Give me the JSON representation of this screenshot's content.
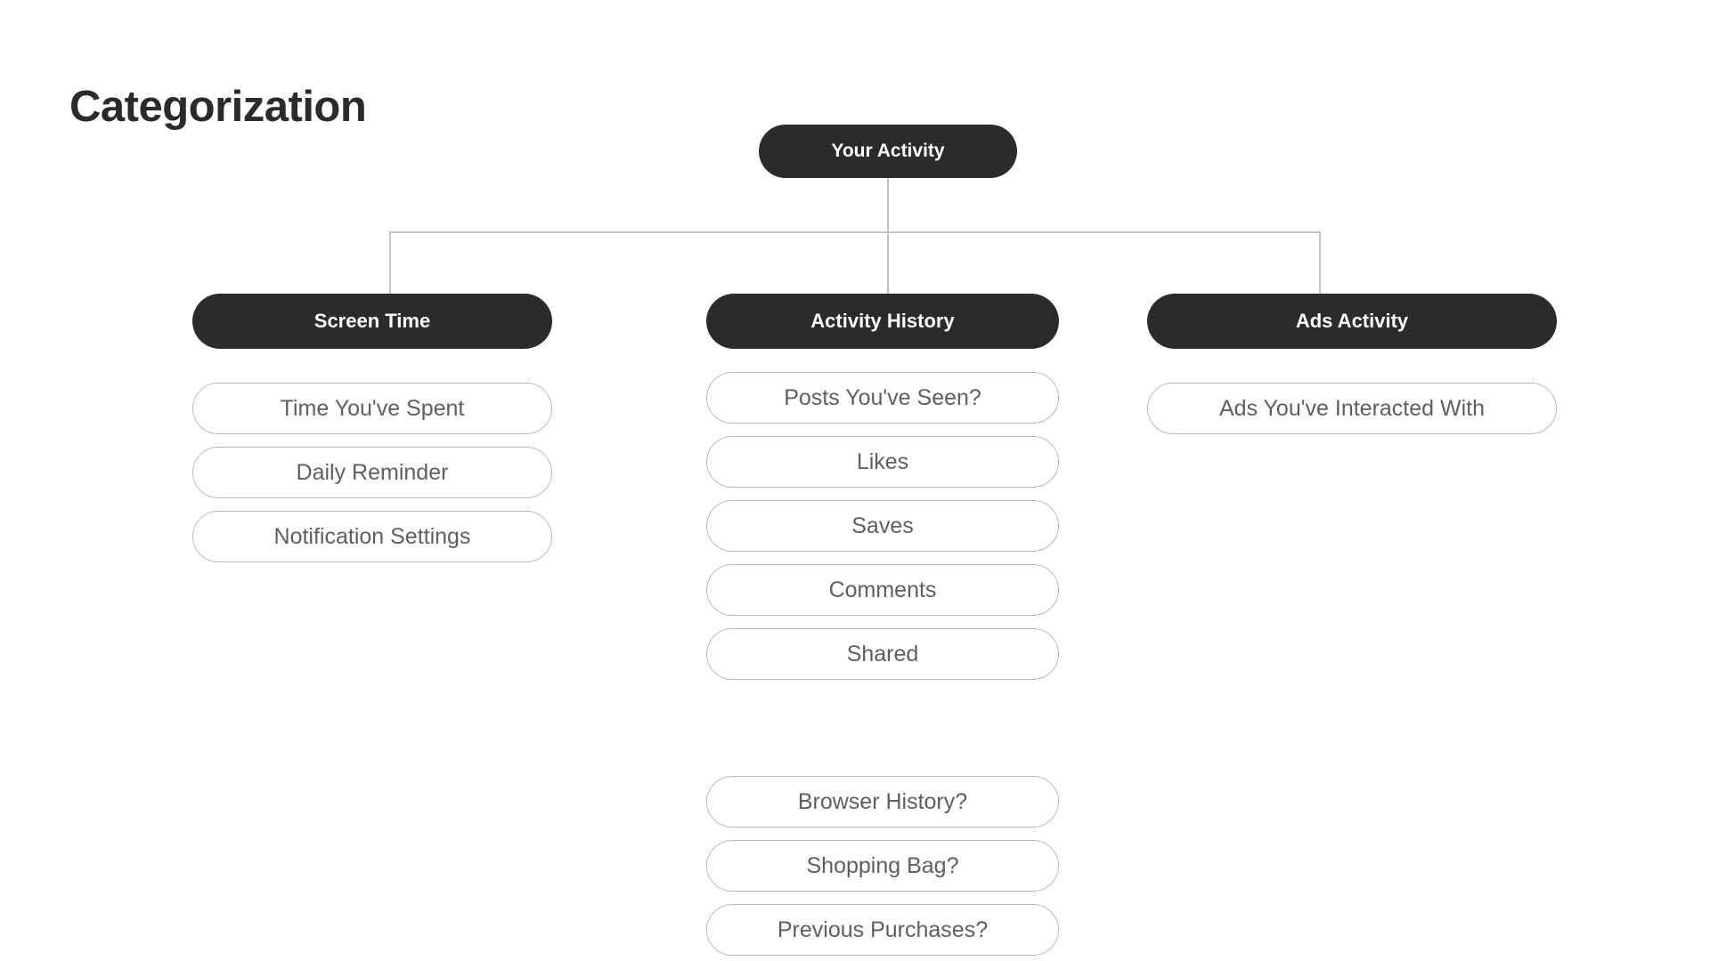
{
  "page": {
    "title": "Categorization",
    "background_color": "#ffffff",
    "node_dark_color": "#2b2b2b",
    "node_light_border_color": "#b9b9b9",
    "node_light_text_color": "#5f5f5f",
    "connector_color": "#c4c4c4"
  },
  "tree": {
    "root": {
      "label": "Your Activity"
    },
    "branches": [
      {
        "header": "Screen Time",
        "groups": [
          {
            "items": [
              {
                "label": "Time You've Spent"
              },
              {
                "label": "Daily Reminder"
              },
              {
                "label": "Notification Settings"
              }
            ]
          }
        ]
      },
      {
        "header": "Activity History",
        "groups": [
          {
            "items": [
              {
                "label": "Posts You've Seen?"
              },
              {
                "label": "Likes"
              },
              {
                "label": "Saves"
              },
              {
                "label": "Comments"
              },
              {
                "label": "Shared"
              }
            ]
          },
          {
            "items": [
              {
                "label": "Browser History?"
              },
              {
                "label": "Shopping Bag?"
              },
              {
                "label": "Previous Purchases?"
              }
            ]
          }
        ]
      },
      {
        "header": "Ads Activity",
        "groups": [
          {
            "items": [
              {
                "label": "Ads You've Interacted With"
              }
            ]
          }
        ]
      }
    ]
  }
}
